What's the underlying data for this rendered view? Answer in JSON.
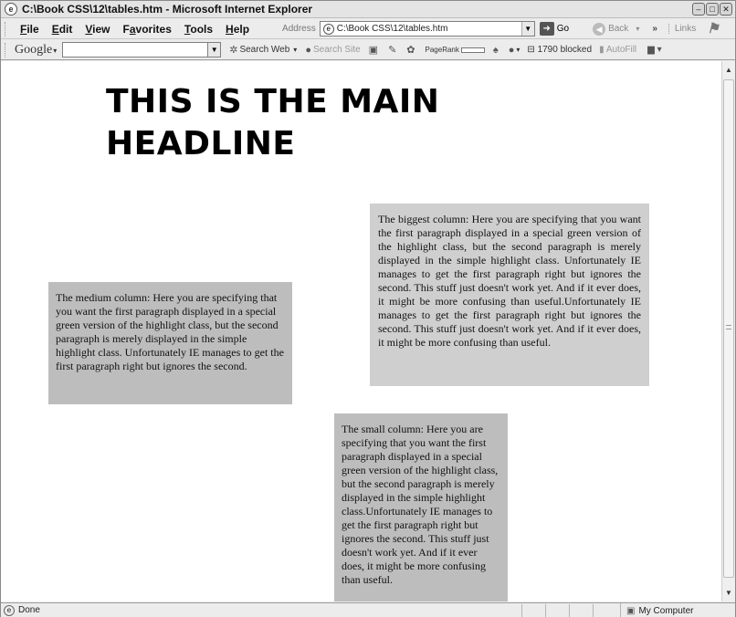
{
  "window": {
    "title": "C:\\Book CSS\\12\\tables.htm - Microsoft Internet Explorer",
    "buttons": [
      "minimize",
      "maximize",
      "close"
    ]
  },
  "menu": {
    "items": [
      {
        "label": "File",
        "key": "F"
      },
      {
        "label": "Edit",
        "key": "E"
      },
      {
        "label": "View",
        "key": "V"
      },
      {
        "label": "Favorites",
        "key": "a"
      },
      {
        "label": "Tools",
        "key": "T"
      },
      {
        "label": "Help",
        "key": "H"
      }
    ]
  },
  "address_bar": {
    "label": "Address",
    "value": "C:\\Book CSS\\12\\tables.htm",
    "go_label": "Go",
    "back_label": "Back",
    "chevron": "»",
    "links_label": "Links"
  },
  "google_toolbar": {
    "logo": "Google",
    "search_value": "",
    "search_web_label": "Search Web",
    "search_site_label": "Search Site",
    "pagerank_label": "PageRank",
    "blocked_label": "1790 blocked",
    "autofill_label": "AutoFill"
  },
  "page": {
    "headline": "THIS IS THE MAIN HEADLINE",
    "medium_column": "The medium column: Here you are specifying that you want the first paragraph displayed in a special green version of the highlight class, but the second paragraph is merely displayed in the simple highlight class. Unfortunately IE manages to get the first paragraph right but ignores the second.",
    "biggest_column": "The biggest column: Here you are specifying that you want the first paragraph displayed in a special green version of the highlight class, but the second paragraph is merely displayed in the simple highlight class. Unfortunately IE manages to get the first paragraph right but ignores the second. This stuff just doesn't work yet. And if it ever does, it might be more confusing than useful.Unfortunately IE manages to get the first paragraph right but ignores the second. This stuff just doesn't work yet. And if it ever does, it might be more confusing than useful.",
    "small_column": "The small column: Here you are specifying that you want the first paragraph displayed in a special green version of the highlight class, but the second paragraph is merely displayed in the simple highlight class.Unfortunately IE manages to get the first paragraph right but ignores the second. This stuff just doesn't work yet. And if it ever does, it might be more confusing than useful."
  },
  "status_bar": {
    "status_text": "Done",
    "zone_label": "My Computer"
  },
  "colors": {
    "column_medium": "#bdbdbd",
    "column_big": "#cfcfcf",
    "column_small": "#bdbdbd"
  }
}
